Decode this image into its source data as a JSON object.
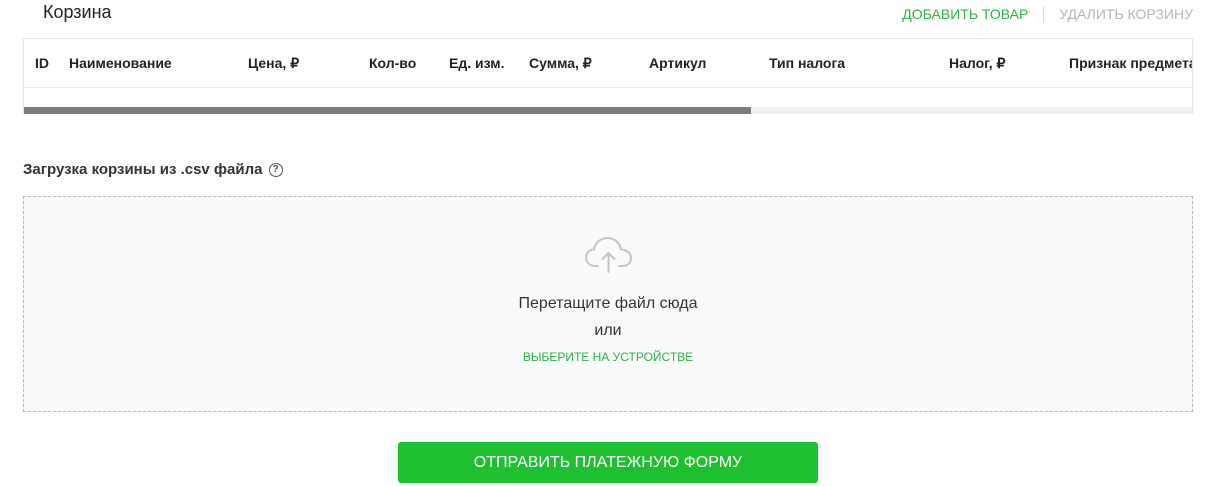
{
  "cart": {
    "title": "Корзина",
    "add_label": "ДОБАВИТЬ ТОВАР",
    "delete_label": "УДАЛИТЬ КОРЗИНУ"
  },
  "table": {
    "columns": [
      "ID",
      "Наименование",
      "Цена, ₽",
      "Кол-во",
      "Ед. изм.",
      "Сумма, ₽",
      "Артикул",
      "Тип налога",
      "Налог, ₽",
      "Признак предмета"
    ],
    "rows": []
  },
  "csv": {
    "label": "Загрузка корзины из .csv файла",
    "help_glyph": "?"
  },
  "dropzone": {
    "icon": "cloud-upload-icon",
    "text": "Перетащите файл сюда",
    "or": "или",
    "select_label": "ВЫБЕРИТЕ НА УСТРОЙСТВЕ"
  },
  "submit": {
    "label": "ОТПРАВИТЬ ПЛАТЕЖНУЮ ФОРМУ"
  },
  "colors": {
    "accent": "#2db14a",
    "button": "#1fbf32",
    "disabled": "#b5b5b5"
  }
}
